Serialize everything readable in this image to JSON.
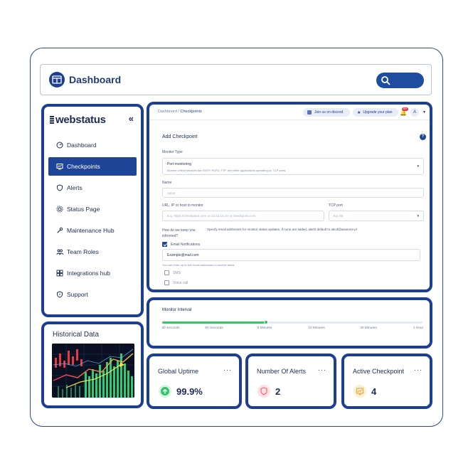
{
  "app": {
    "title": "Dashboard"
  },
  "sidebar": {
    "brand": "webstatus",
    "items": [
      {
        "label": "Dashboard",
        "icon": "dashboard-icon"
      },
      {
        "label": "Checkpoints",
        "icon": "checkpoint-icon",
        "active": true
      },
      {
        "label": "Alerts",
        "icon": "shield-icon"
      },
      {
        "label": "Status Page",
        "icon": "gear-icon"
      },
      {
        "label": "Maintenance Hub",
        "icon": "wrench-icon"
      },
      {
        "label": "Team Roles",
        "icon": "team-icon"
      },
      {
        "label": "Integrations hub",
        "icon": "integrations-icon"
      },
      {
        "label": "Support",
        "icon": "support-icon"
      }
    ]
  },
  "historical": {
    "title": "Historical Data"
  },
  "topbar": {
    "breadcrumb_root": "Dashboard /",
    "breadcrumb_current": "Checkpoints",
    "discord_label": "Join us on discord",
    "upgrade_label": "Upgrade your plan",
    "notification_count": "99+",
    "avatar_initial": "A"
  },
  "form": {
    "title": "Add Checkpoint",
    "help": "?",
    "monitor_type_label": "Monitor Type",
    "monitor_type_value": "Port monitoring",
    "monitor_type_desc": "Monitor critical services like SMTP, POP3, FTP, and other applications operating on TCP ports.",
    "name_label": "Name",
    "name_placeholder": "name",
    "url_label": "URL, IP or host to monitor",
    "url_placeholder": "E.g. https://checkpoint.com or 22.32.10.10 or checkpoint.com",
    "tcp_label": "TCP port",
    "tcp_placeholder": "Eg: 80",
    "keep_informed_label": "How do we keep you informed?",
    "keep_informed_desc": "Specify email addresses for monitor status updates. If none are added, alerts default to abcd@aaveone.pl",
    "email_notifications_label": "Email Notifications",
    "email_value": "Example@mail.com",
    "email_hint": "You can enter up to five email addresses to receive alerts",
    "sms_label": "SMS",
    "voice_label": "Voice call"
  },
  "interval": {
    "title": "Monitor Interval",
    "fraction": 0.4,
    "ticks": [
      "30 Seconds",
      "60 Seconds",
      "5 Minutes",
      "10 Minutes",
      "30 Minutes",
      "1 Hour"
    ]
  },
  "stats": [
    {
      "title": "Global Uptime",
      "value": "99.9%",
      "icon": "arrow-up-icon",
      "color": "#34c26a",
      "bg": "#d9f4e3"
    },
    {
      "title": "Number Of Alerts",
      "value": "2",
      "icon": "shield-alert-icon",
      "color": "#f06a7a",
      "bg": "#fde1e5"
    },
    {
      "title": "Active Checkpoint",
      "value": "4",
      "icon": "chart-icon",
      "color": "#e7a93a",
      "bg": "#fcefd5"
    }
  ],
  "colors": {
    "primary": "#1d3f91",
    "accent": "#1e4598",
    "success": "#3bc46a"
  }
}
